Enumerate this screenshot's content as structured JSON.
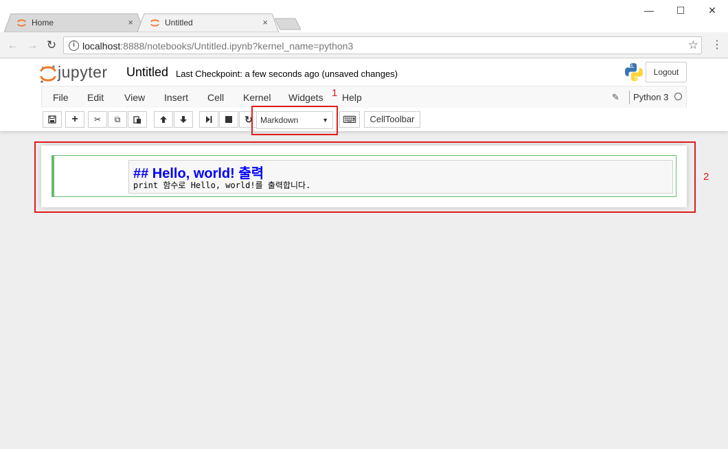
{
  "browser": {
    "tabs": [
      {
        "label": "Home",
        "close": "×",
        "icon": "jupyter-favicon",
        "active": false
      },
      {
        "label": "Untitled",
        "close": "×",
        "icon": "jupyter-favicon",
        "active": true
      }
    ],
    "window_controls": {
      "minimize": "—",
      "maximize": "☐",
      "close": "✕"
    },
    "nav": {
      "back": "←",
      "forward": "→",
      "reload": "↻"
    },
    "address": {
      "host": "localhost",
      "rest": ":8888/notebooks/Untitled.ipynb?kernel_name=python3"
    },
    "bookmark_star": "☆",
    "menu_dots": "⋮"
  },
  "jupyter": {
    "logo_text": "jupyter",
    "notebook_title": "Untitled",
    "checkpoint": "Last Checkpoint: a few seconds ago (unsaved changes)",
    "logout_label": "Logout",
    "menu": [
      "File",
      "Edit",
      "View",
      "Insert",
      "Cell",
      "Kernel",
      "Widgets",
      "Help"
    ],
    "edit_icon": "✎",
    "kernel_name": "Python 3",
    "toolbar": {
      "save": "💾",
      "add": "+",
      "cut": "✂",
      "copy": "⧉",
      "paste": "📋",
      "move_up": "🡑",
      "move_down": "🡓",
      "run": "⏭",
      "stop": "■",
      "restart": "↻",
      "cell_type": "Markdown",
      "cell_type_caret": "▼",
      "keyboard": "⌨",
      "celltoolbar_label": "CellToolbar"
    }
  },
  "cell": {
    "heading": "## Hello, world! 출력",
    "text": "print 함수로 Hello, world!를 출력합니다."
  },
  "annotations": {
    "one": "1",
    "two": "2"
  },
  "colors": {
    "annotation": "#e01b1b",
    "selected_cell_border": "#66bb6a",
    "heading": "#0000ff",
    "jupyter_orange": "#f37626"
  }
}
